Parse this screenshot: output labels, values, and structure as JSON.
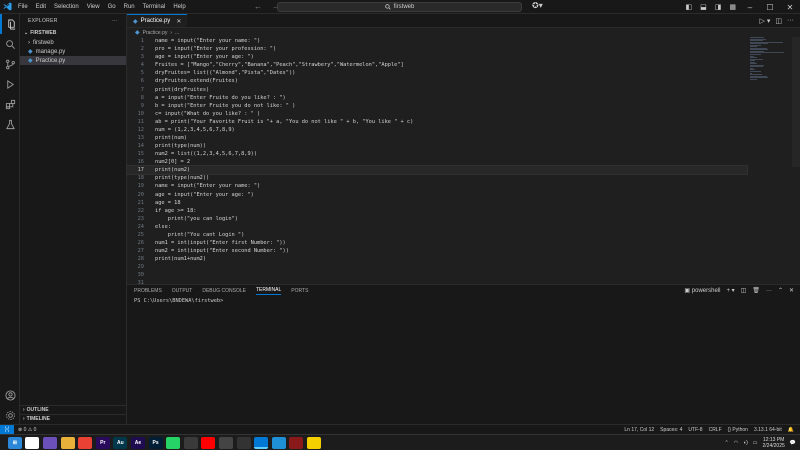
{
  "titlebar": {
    "menu": [
      "File",
      "Edit",
      "Selection",
      "View",
      "Go",
      "Run",
      "Terminal",
      "Help"
    ],
    "search_text": "firstweb",
    "icons": [
      "vscode-logo",
      "back-arrow",
      "forward-arrow",
      "search-icon",
      "copilot-icon",
      "layout-icons",
      "minimize",
      "maximize",
      "close"
    ]
  },
  "sidebar": {
    "title": "EXPLORER",
    "section": "FIRSTWEB",
    "items": [
      {
        "label": "firstweb",
        "type": "folder"
      },
      {
        "label": "manage.py",
        "type": "python"
      },
      {
        "label": "Practice.py",
        "type": "python",
        "selected": true
      }
    ],
    "outline": "OUTLINE",
    "timeline": "TIMELINE"
  },
  "editor": {
    "tab_label": "Practice.py",
    "breadcrumb": [
      "Practice.py",
      "..."
    ],
    "current_line": 17,
    "lines": [
      "name = input(\"Enter your name: \")",
      "pro = input(\"Enter your profession: \")",
      "age = input(\"Enter your age: \")",
      "Fruites = [\"Mango\",\"Cherry\",\"Banana\",\"Peach\",\"Strawbery\",\"Watermelon\",\"Apple\"]",
      "dryFruites= list((\"Almond\",\"Pista\",\"Dates\"))",
      "dryFruites.extend(Fruites)",
      "print(dryFruites)",
      "a = input(\"Enter Fruite do you like? : \")",
      "b = input(\"Enter Fruite you do not like: \" )",
      "c= input(\"What do you like? : \" )",
      "ab = print(\"Your Favorite Fruit is \"+ a, \"You do not like \" + b, \"You like \" + c)",
      "num = (1,2,3,4,5,6,7,8,9)",
      "print(num)",
      "print(type(num))",
      "num2 = list((1,2,3,4,5,6,7,8,9))",
      "num2[0] = 2",
      "print(num2)",
      "print(type(num2))",
      "name = input(\"Enter your name: \")",
      "age = input(\"Enter your age: \")",
      "age = 18",
      "if age >= 18:",
      "    print(\"you can login\")",
      "else:",
      "    print(\"You cant Login \")",
      "num1 = int(input(\"Enter first Number: \"))",
      "num2 = int(input(\"Enter second Number: \"))",
      "print(num1+num2)",
      "",
      "",
      ""
    ]
  },
  "panel": {
    "tabs": [
      "PROBLEMS",
      "OUTPUT",
      "DEBUG CONSOLE",
      "TERMINAL",
      "PORTS"
    ],
    "active_tab": "TERMINAL",
    "shell": "powershell",
    "prompt": "PS C:\\Users\\BNDEWA\\firstweb>"
  },
  "statusbar": {
    "errors": "0",
    "warnings": "0",
    "position": "Ln 17, Col 12",
    "spaces": "Spaces: 4",
    "encoding": "UTF-8",
    "eol": "CRLF",
    "language": "Python",
    "interpreter": "3.13.1 64-bit"
  },
  "taskbar": {
    "time": "12:13 PM",
    "date": "2/24/2025",
    "apps": [
      {
        "name": "start",
        "color": "#2b88d8",
        "label": "⊞"
      },
      {
        "name": "chrome",
        "color": "#ffffff",
        "label": ""
      },
      {
        "name": "copilot",
        "color": "#6b4fbb",
        "label": ""
      },
      {
        "name": "explorer",
        "color": "#e8b23a",
        "label": ""
      },
      {
        "name": "chrome-2",
        "color": "#e94235",
        "label": ""
      },
      {
        "name": "premiere",
        "color": "#2a0a5c",
        "label": "Pr"
      },
      {
        "name": "audition",
        "color": "#00374a",
        "label": "Au"
      },
      {
        "name": "after-effects",
        "color": "#1f0b4f",
        "label": "Ae"
      },
      {
        "name": "photoshop",
        "color": "#001e36",
        "label": "Ps"
      },
      {
        "name": "whatsapp",
        "color": "#25d366",
        "label": ""
      },
      {
        "name": "store",
        "color": "#3a3a3a",
        "label": ""
      },
      {
        "name": "youtube",
        "color": "#ff0000",
        "label": ""
      },
      {
        "name": "settings",
        "color": "#444",
        "label": ""
      },
      {
        "name": "chatgpt",
        "color": "#333",
        "label": ""
      },
      {
        "name": "vscode",
        "color": "#0078d4",
        "label": ""
      },
      {
        "name": "edge",
        "color": "#1f8fd6",
        "label": ""
      },
      {
        "name": "app-red",
        "color": "#8a1a1a",
        "label": ""
      },
      {
        "name": "sticky",
        "color": "#f4d000",
        "label": ""
      }
    ]
  }
}
